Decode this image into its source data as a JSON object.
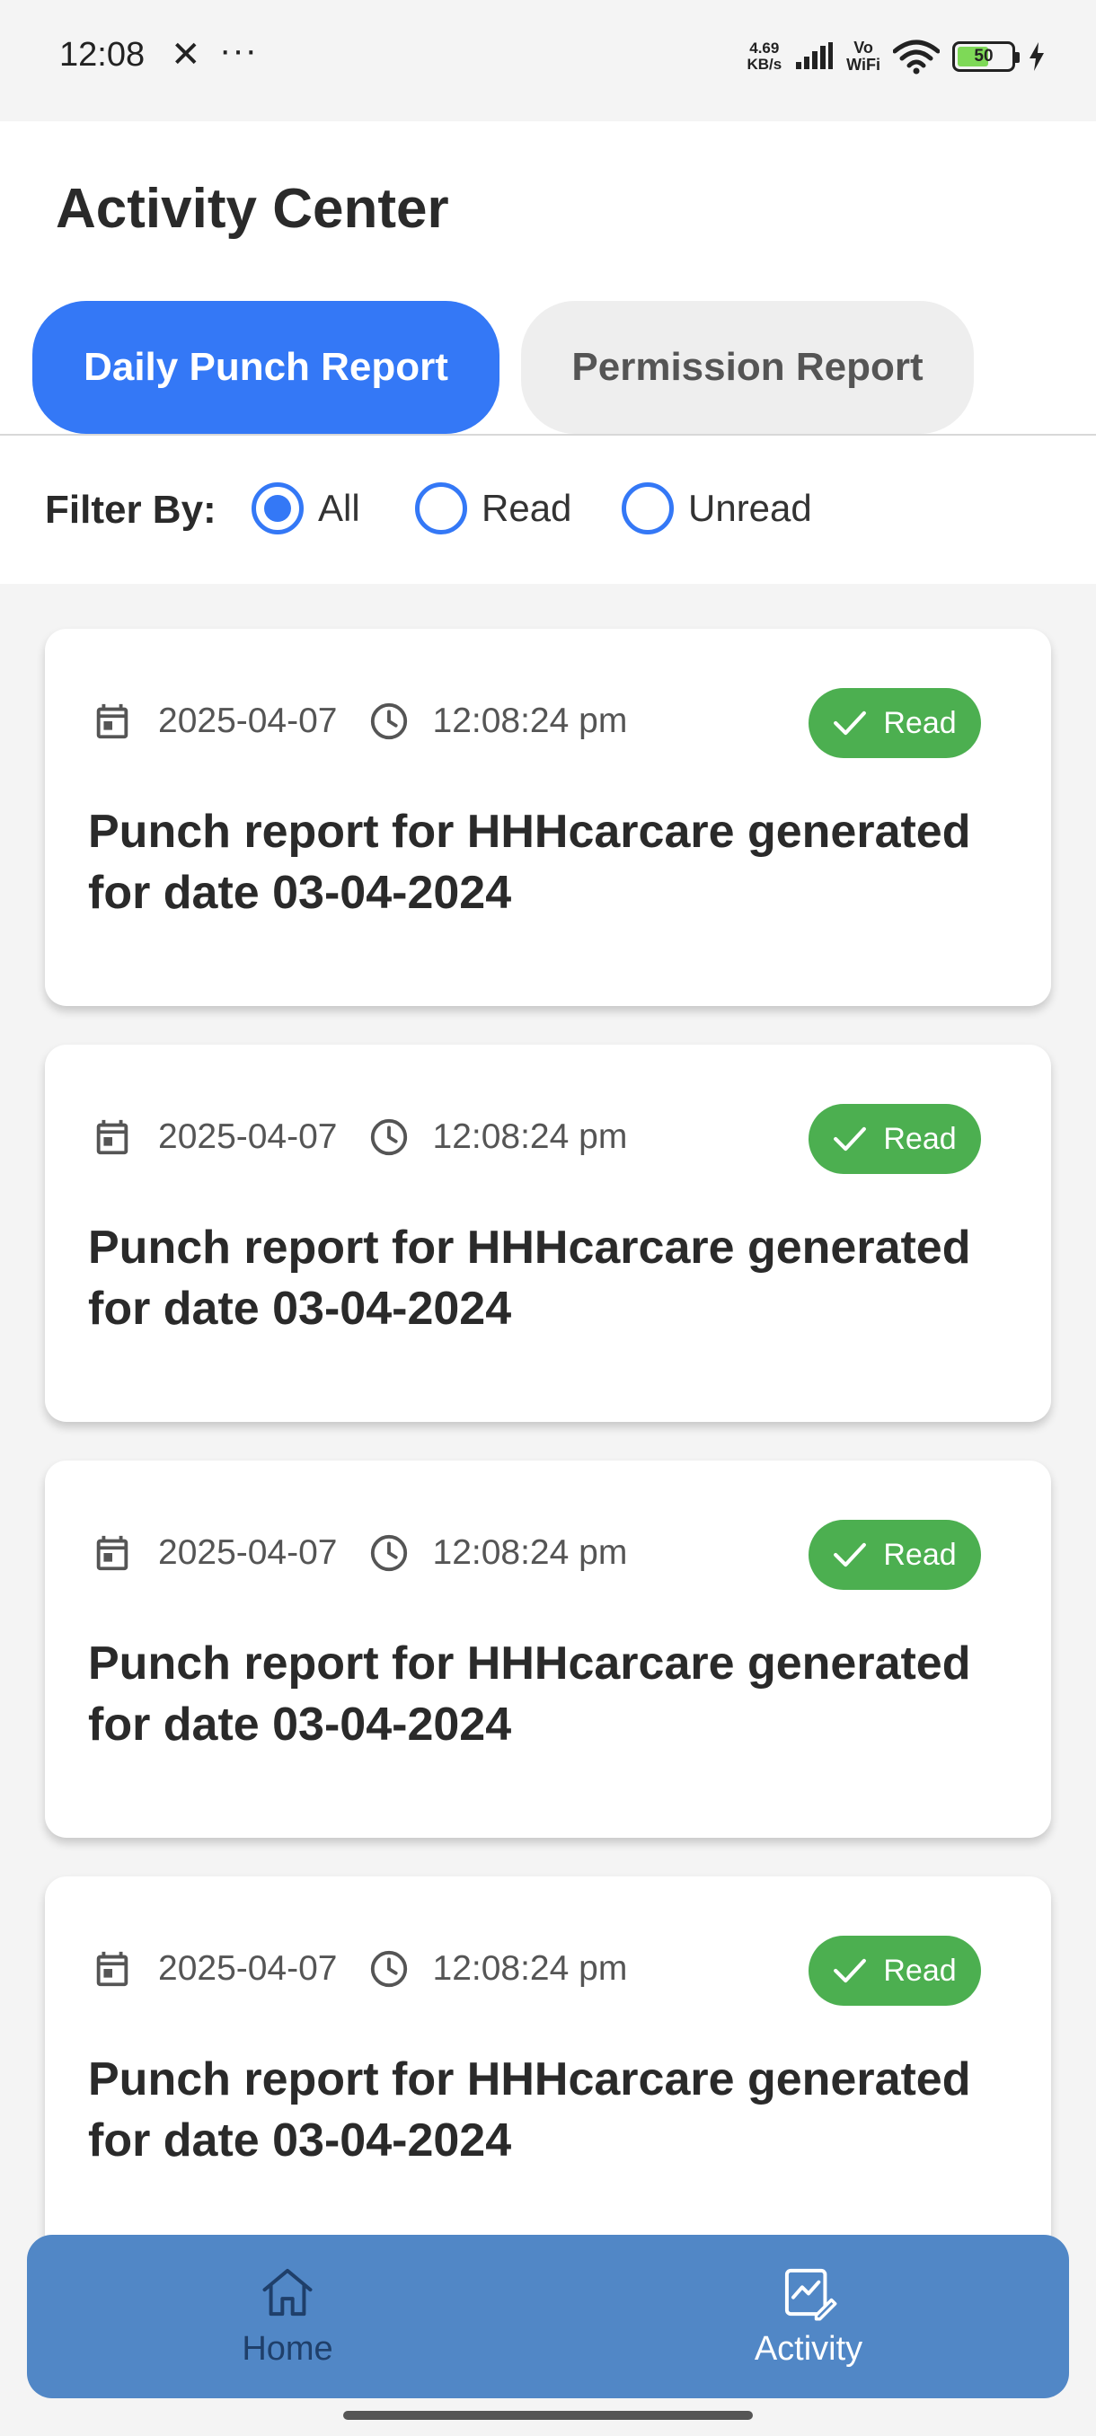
{
  "status_bar": {
    "time": "12:08",
    "net_speed_value": "4.69",
    "net_speed_unit": "KB/s",
    "vowifi_top": "Vo",
    "vowifi_bottom": "WiFi",
    "battery": "50"
  },
  "header": {
    "title": "Activity Center",
    "tabs": [
      {
        "label": "Daily Punch Report",
        "active": true
      },
      {
        "label": "Permission Report",
        "active": false
      }
    ]
  },
  "filter": {
    "label": "Filter By:",
    "options": [
      {
        "label": "All",
        "selected": true
      },
      {
        "label": "Read",
        "selected": false
      },
      {
        "label": "Unread",
        "selected": false
      }
    ]
  },
  "reports": [
    {
      "date": "2025-04-07",
      "time": "12:08:24 pm",
      "status": "Read",
      "text": "Punch report for HHHcarcare generated for date 03-04-2024"
    },
    {
      "date": "2025-04-07",
      "time": "12:08:24 pm",
      "status": "Read",
      "text": "Punch report for HHHcarcare generated for date 03-04-2024"
    },
    {
      "date": "2025-04-07",
      "time": "12:08:24 pm",
      "status": "Read",
      "text": "Punch report for HHHcarcare generated for date 03-04-2024"
    },
    {
      "date": "2025-04-07",
      "time": "12:08:24 pm",
      "status": "Read",
      "text": "Punch report for HHHcarcare generated for date 03-04-2024"
    }
  ],
  "bottom_nav": {
    "items": [
      {
        "label": "Home",
        "icon": "home-icon"
      },
      {
        "label": "Activity",
        "icon": "activity-icon"
      }
    ]
  },
  "colors": {
    "primary": "#3478f6",
    "badge_read": "#4caf50",
    "nav_bg": "#5187c6"
  }
}
